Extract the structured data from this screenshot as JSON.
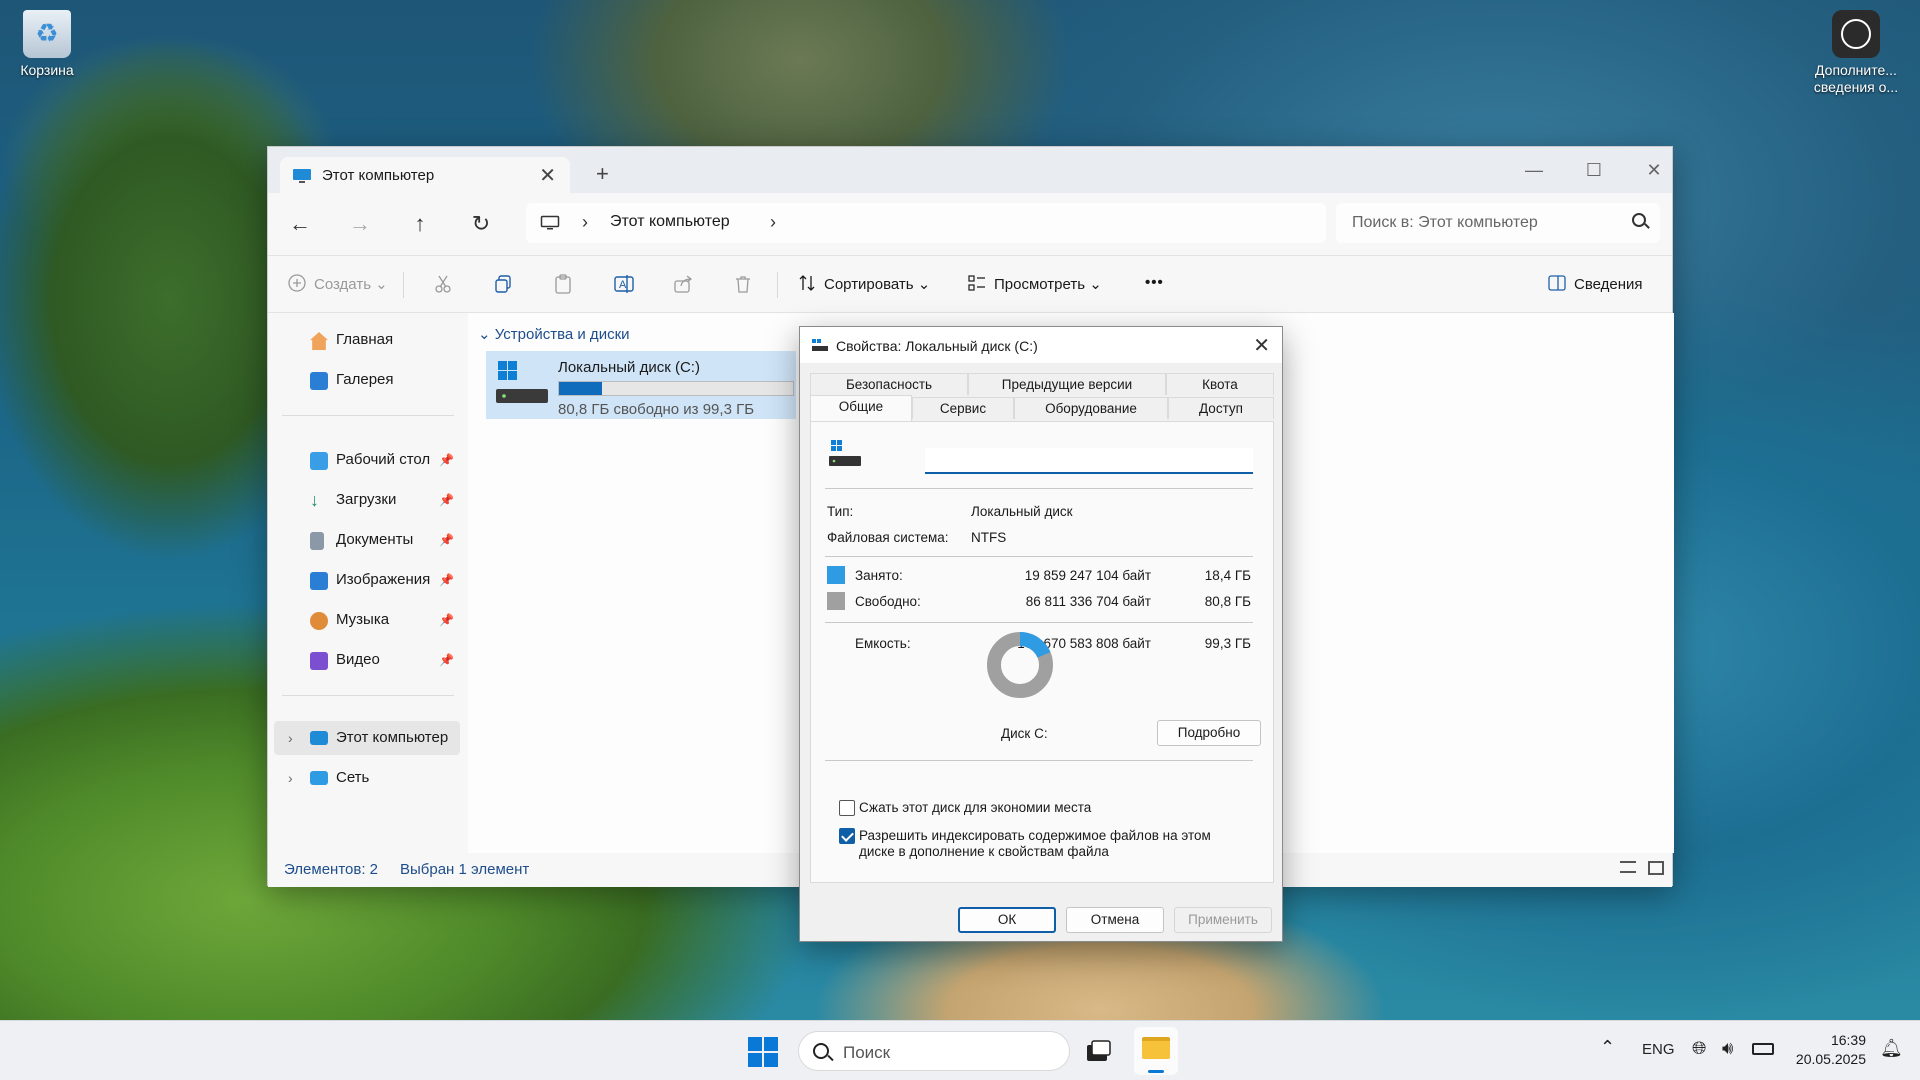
{
  "desktop": {
    "recycle_bin_label": "Корзина",
    "more_info_label": "Дополните... сведения о..."
  },
  "explorer": {
    "tab_title": "Этот компьютер",
    "new_tab": "+",
    "tab_close": "✕",
    "window_controls": {
      "minimize": "—",
      "maximize": "☐",
      "close": "✕"
    },
    "nav": {
      "back": "←",
      "forward": "→",
      "up": "↑",
      "refresh": "↻"
    },
    "breadcrumb": "Этот компьютер",
    "search_placeholder": "Поиск в: Этот компьютер",
    "toolbar": {
      "create": "Создать",
      "sort": "Сортировать",
      "view": "Просмотреть",
      "more": "•••",
      "details": "Сведения"
    },
    "sidebar": {
      "home": "Главная",
      "gallery": "Галерея",
      "desktop": "Рабочий стол",
      "downloads": "Загрузки",
      "documents": "Документы",
      "pictures": "Изображения",
      "music": "Музыка",
      "videos": "Видео",
      "this_pc": "Этот компьютер",
      "network": "Сеть"
    },
    "group_header": "Устройства и диски",
    "drive": {
      "name": "Локальный диск (C:)",
      "free_text": "80,8 ГБ свободно из 99,3 ГБ",
      "used_fraction": 0.185
    },
    "status": {
      "items": "Элементов: 2",
      "selected": "Выбран 1 элемент"
    }
  },
  "dialog": {
    "title": "Свойства: Локальный диск (C:)",
    "tabs_row1": [
      "Безопасность",
      "Предыдущие версии",
      "Квота"
    ],
    "tabs_row2": [
      "Общие",
      "Сервис",
      "Оборудование",
      "Доступ"
    ],
    "volume_label_value": "",
    "type_label": "Тип:",
    "type_value": "Локальный диск",
    "fs_label": "Файловая система:",
    "fs_value": "NTFS",
    "used_label": "Занято:",
    "used_bytes": "19 859 247 104 байт",
    "used_size": "18,4 ГБ",
    "free_label": "Свободно:",
    "free_bytes": "86 811 336 704 байт",
    "free_size": "80,8 ГБ",
    "capacity_label": "Емкость:",
    "capacity_bytes": "106 670 583 808 байт",
    "capacity_size": "99,3 ГБ",
    "disk_label": "Диск C:",
    "details_button": "Подробно",
    "compress_label": "Сжать этот диск для экономии места",
    "compress_checked": false,
    "index_label": "Разрешить индексировать содержимое файлов на этом диске в дополнение к свойствам файла",
    "index_checked": true,
    "ok": "ОК",
    "cancel": "Отмена",
    "apply": "Применить",
    "colors": {
      "used": "#2f9be3",
      "free": "#a0a0a0"
    },
    "used_fraction": 0.186
  },
  "taskbar": {
    "search_placeholder": "Поиск",
    "language": "ENG",
    "time": "16:39",
    "date": "20.05.2025"
  }
}
